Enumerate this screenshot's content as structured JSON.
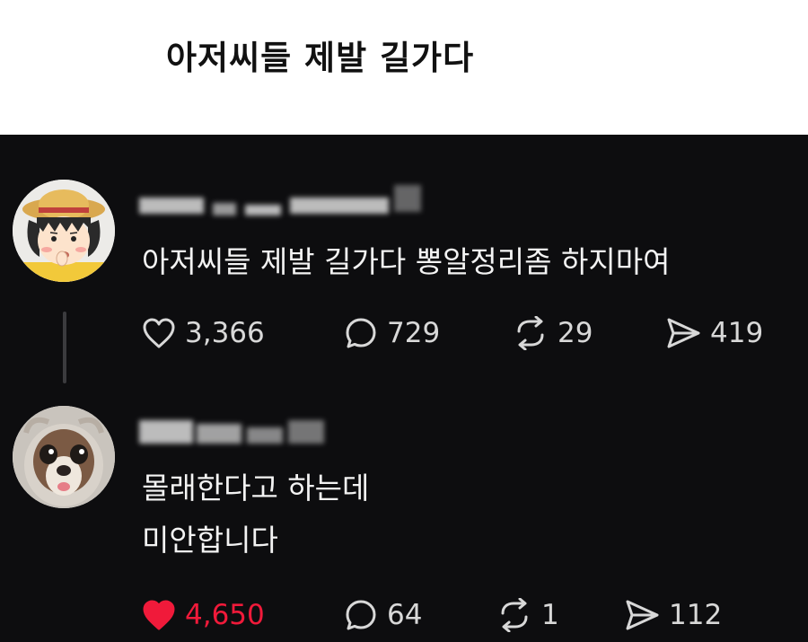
{
  "title": "아저씨들 제발 길가다",
  "colors": {
    "background": "#0d0d0f",
    "text": "#f3f3f3",
    "icon": "#d8d8d8",
    "liked": "#f01a3a"
  },
  "posts": [
    {
      "avatar": "cartoon-girl-avatar",
      "text": "아저씨들 제발 길가다 뽕알정리좀 하지마여",
      "liked": false,
      "likes": "3,366",
      "replies": "729",
      "reposts": "29",
      "shares": "419"
    },
    {
      "avatar": "dog-avatar",
      "text": "몰래한다고 하는데\n미안합니다",
      "liked": true,
      "likes": "4,650",
      "replies": "64",
      "reposts": "1",
      "shares": "112"
    }
  ]
}
